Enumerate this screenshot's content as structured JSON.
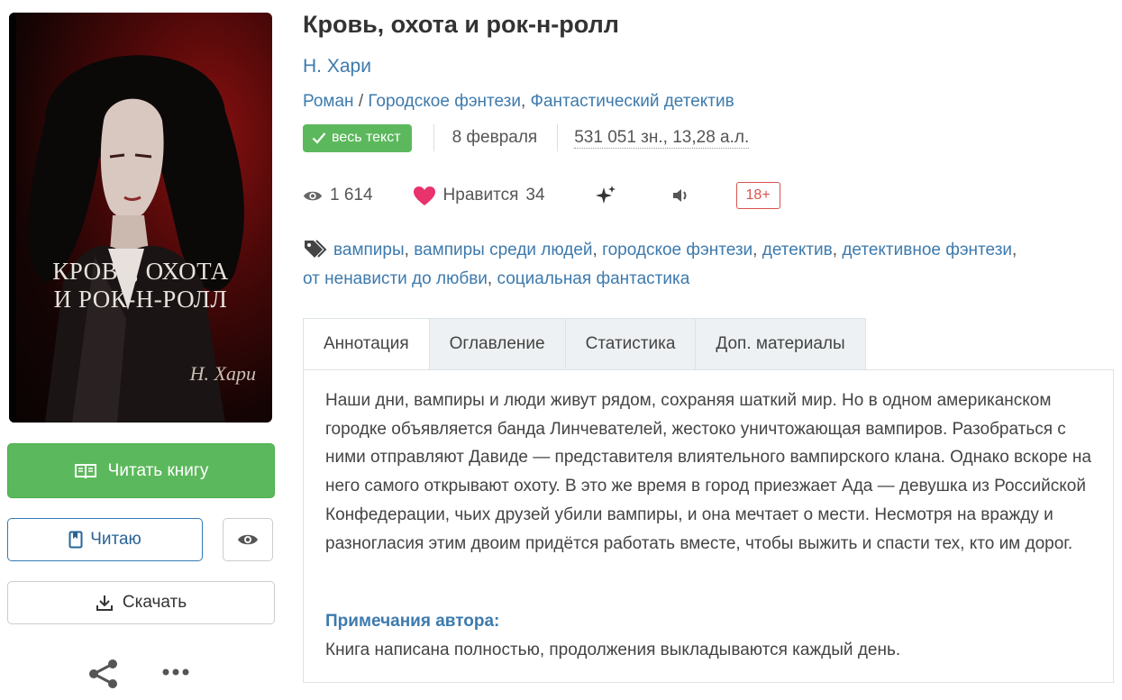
{
  "book": {
    "title": "Кровь, охота и рок-н-ролл",
    "author": "Н. Хари",
    "genre_main": "Роман",
    "genre_sep": "/",
    "genre_1": "Городское фэнтези",
    "genre_2": "Фантастический детектив"
  },
  "cover": {
    "title_line1": "КРОВЬ, ОХОТА",
    "title_line2": "И РОК-Н-РОЛЛ",
    "author": "Н. Хари"
  },
  "meta": {
    "status_badge": "весь текст",
    "date": "8 февраля",
    "size": "531 051 зн., 13,28 а.л."
  },
  "stats": {
    "views": "1 614",
    "likes_label": "Нравится",
    "likes_count": "34",
    "age_rating": "18+"
  },
  "tags": [
    "вампиры",
    "вампиры среди людей",
    "городское фэнтези",
    "детектив",
    "детективное фэнтези",
    "от ненависти до любви",
    "социальная фантастика"
  ],
  "actions": {
    "read_book": "Читать книгу",
    "reading": "Читаю",
    "download": "Скачать"
  },
  "tabs": [
    "Аннотация",
    "Оглавление",
    "Статистика",
    "Доп. материалы"
  ],
  "annotation": "Наши дни, вампиры и люди живут рядом, сохраняя шаткий мир. Но в одном американском городке объявляется банда Линчевателей, жестоко уничтожающая вампиров. Разобраться с ними отправляют Давиде — представителя влиятельного вампирского клана. Однако вскоре на него самого открывают охоту. В это же время в город приезжает Ада — девушка из Российской Конфедерации, чьих друзей убили вампиры, и она мечтает о мести. Несмотря на вражду и разногласия этим двоим придётся работать вместе, чтобы выжить и спасти тех, кто им дорог.",
  "notes": {
    "title": "Примечания автора:",
    "text": "Книга написана полностью, продолжения выкладываются каждый день."
  },
  "colors": {
    "accent_blue": "#3d7aad",
    "green": "#5cb85c",
    "like_pink": "#e8336d",
    "age_red": "#d9534f"
  }
}
